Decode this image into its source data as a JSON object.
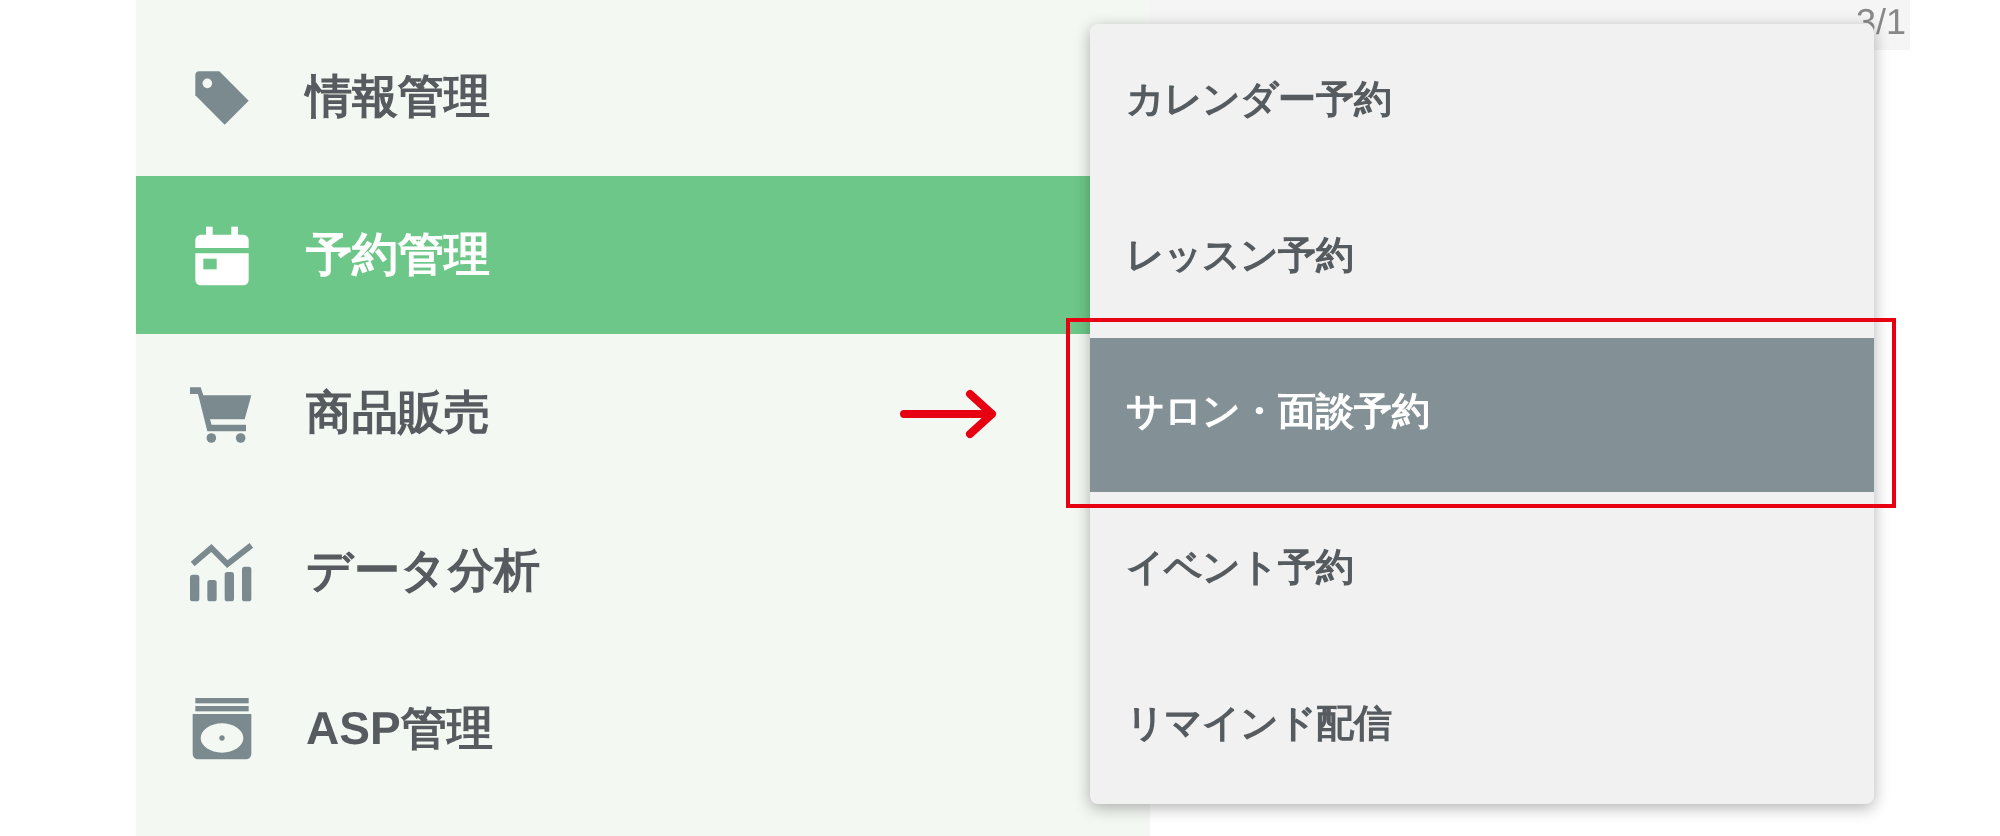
{
  "sidebar": {
    "items": [
      {
        "label": "情報管理",
        "kind": "tag",
        "selected": false
      },
      {
        "label": "予約管理",
        "kind": "calendar",
        "selected": true
      },
      {
        "label": "商品販売",
        "kind": "cart",
        "selected": false
      },
      {
        "label": "データ分析",
        "kind": "chart",
        "selected": false
      },
      {
        "label": "ASP管理",
        "kind": "archive",
        "selected": false
      }
    ]
  },
  "page": {
    "corner_text": "3/1"
  },
  "submenu": {
    "items": [
      {
        "label": "カレンダー予約",
        "selected": false
      },
      {
        "label": "レッスン予約",
        "selected": false
      },
      {
        "label": "サロン・面談予約",
        "selected": true
      },
      {
        "label": "イベント予約",
        "selected": false
      },
      {
        "label": "リマインド配信",
        "selected": false
      }
    ]
  }
}
